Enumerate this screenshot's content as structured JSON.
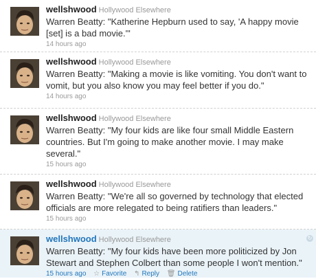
{
  "tweets": [
    {
      "username": "wellshwood",
      "display_name": "Hollywood Elsewhere",
      "text": "Warren Beatty: \"Katherine Hepburn used to say, 'A happy movie [set] is a bad movie.'\"",
      "timestamp": "14 hours ago"
    },
    {
      "username": "wellshwood",
      "display_name": "Hollywood Elsewhere",
      "text": "Warren Beatty: \"Making a movie is like vomiting. You don't want to vomit, but you also know you may feel better if you do.\"",
      "timestamp": "14 hours ago"
    },
    {
      "username": "wellshwood",
      "display_name": "Hollywood Elsewhere",
      "text": "Warren Beatty: \"My four kids are like four small Middle Eastern countries. But I'm going to make another movie. I may make several.\"",
      "timestamp": "15 hours ago"
    },
    {
      "username": "wellshwood",
      "display_name": "Hollywood Elsewhere",
      "text": "Warren Beatty: \"We're all so governed by technology that elected officials are more relegated to being ratifiers than leaders.\"",
      "timestamp": "15 hours ago"
    },
    {
      "username": "wellshwood",
      "display_name": "Hollywood Elsewhere",
      "text": "Warren Beatty: \"My four kids have been more politicized by Jon Stewart and Stephen Colbert than some people I won't mention.\"",
      "timestamp": "15 hours ago",
      "actions": {
        "favorite": "Favorite",
        "reply": "Reply",
        "delete": "Delete"
      }
    }
  ],
  "icons": {
    "favorite": "star-icon",
    "reply": "reply-arrow-icon",
    "delete": "trash-icon",
    "retweet_toggle": "retweet-icon"
  },
  "colors": {
    "link_blue": "#2276bb",
    "hover_background": "#eaf3f8",
    "meta_gray": "#999999"
  }
}
